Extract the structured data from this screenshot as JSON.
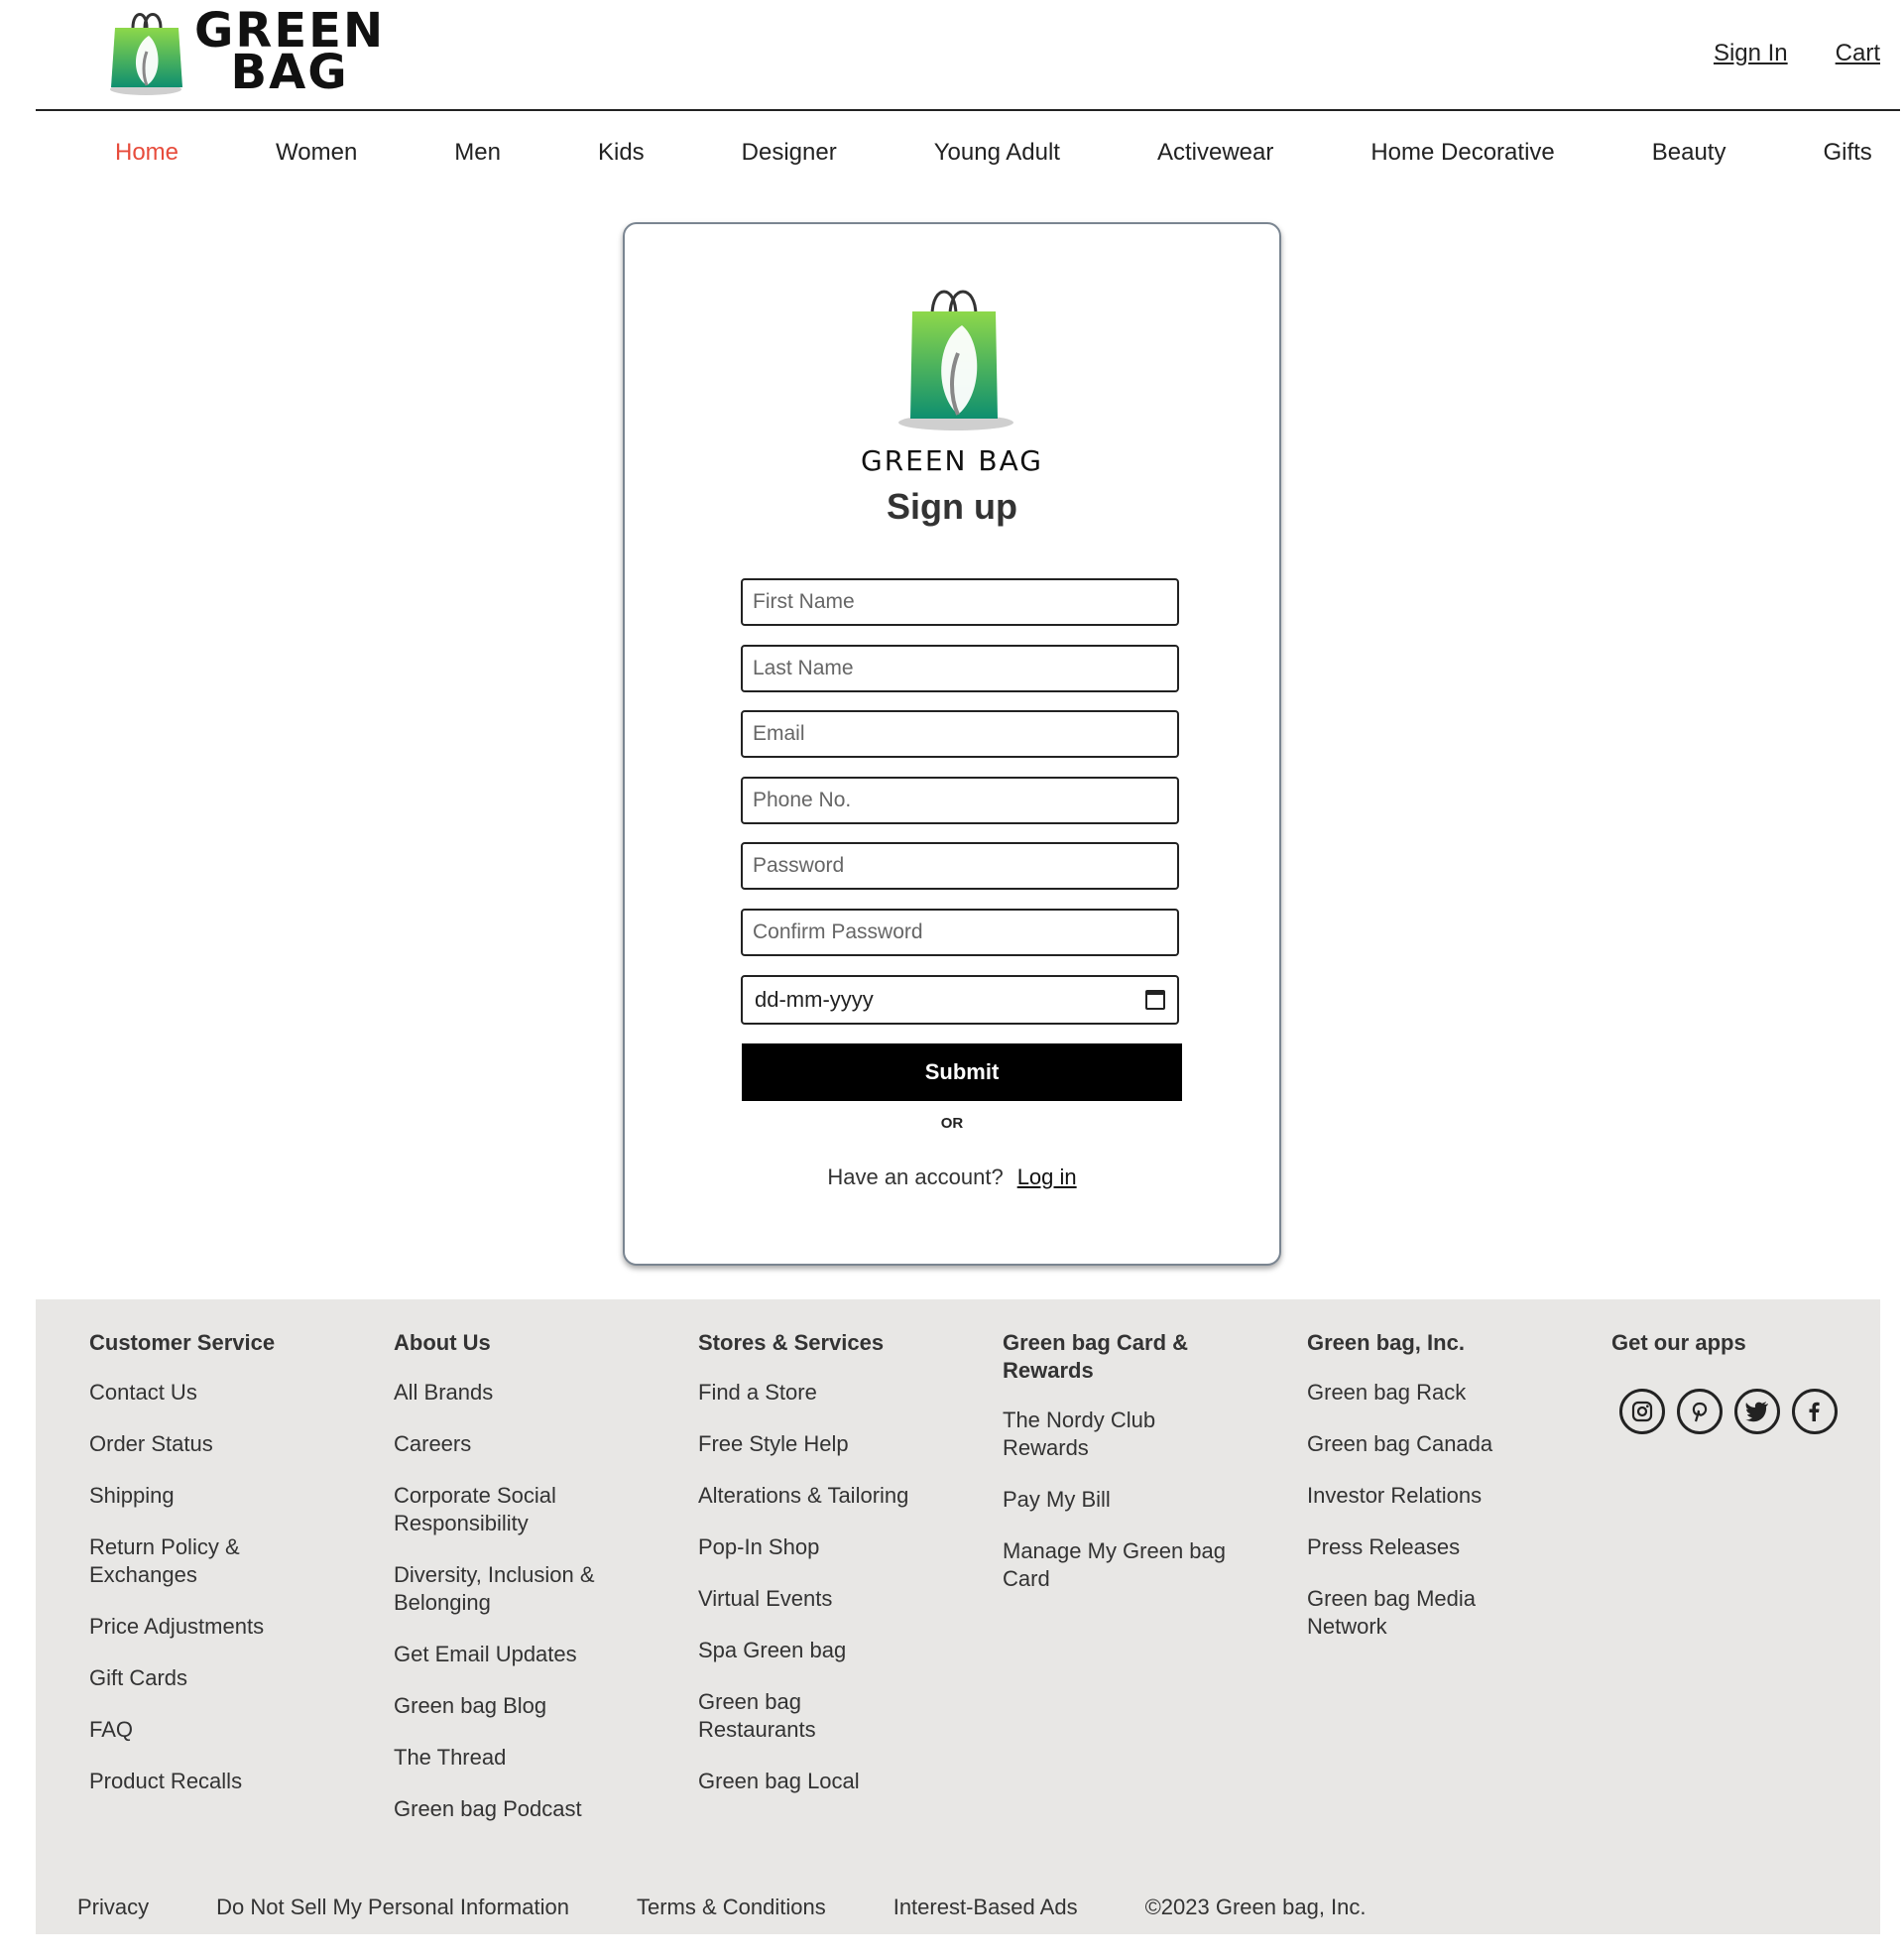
{
  "header": {
    "brand_line1": "GREEN",
    "brand_line2": "BAG",
    "sign_in": "Sign In",
    "cart": "Cart"
  },
  "nav": {
    "items": [
      "Home",
      "Women",
      "Men",
      "Kids",
      "Designer",
      "Young Adult",
      "Activewear",
      "Home Decorative",
      "Beauty",
      "Gifts"
    ],
    "active": "Home"
  },
  "signup": {
    "brand": "GREEN BAG",
    "title": "Sign up",
    "first_name_placeholder": "First Name",
    "last_name_placeholder": "Last Name",
    "email_placeholder": "Email",
    "phone_placeholder": "Phone No.",
    "password_placeholder": "Password",
    "confirm_password_placeholder": "Confirm Password",
    "date_placeholder": "dd-mm-yyyy",
    "submit_label": "Submit",
    "or_label": "OR",
    "have_account": "Have an account?",
    "login_link": "Log in"
  },
  "footer": {
    "columns": [
      {
        "title": "Customer Service",
        "items": [
          "Contact Us",
          "Order Status",
          "Shipping",
          "Return Policy & Exchanges",
          "Price Adjustments",
          "Gift Cards",
          "FAQ",
          "Product Recalls"
        ]
      },
      {
        "title": "About Us",
        "items": [
          "All Brands",
          "Careers",
          "Corporate Social Responsibility",
          "Diversity, Inclusion & Belonging",
          "Get Email Updates",
          "Green bag Blog",
          "The Thread",
          "Green bag Podcast"
        ]
      },
      {
        "title": "Stores & Services",
        "items": [
          "Find a Store",
          "Free Style Help",
          "Alterations & Tailoring",
          "Pop-In Shop",
          "Virtual Events",
          "Spa Green bag",
          "Green bag Restaurants",
          "Green bag Local"
        ]
      },
      {
        "title": "Green bag Card & Rewards",
        "items": [
          "The Nordy Club Rewards",
          "Pay My Bill",
          "Manage My Green bag Card"
        ]
      },
      {
        "title": "Green bag, Inc.",
        "items": [
          "Green bag Rack",
          "Green bag Canada",
          "Investor Relations",
          "Press Releases",
          "Green bag Media Network"
        ]
      }
    ],
    "apps_title": "Get our apps",
    "apps": [
      "instagram-icon",
      "pinterest-icon",
      "twitter-icon",
      "facebook-icon"
    ],
    "legal": [
      "Privacy",
      "Do Not Sell My Personal Information",
      "Terms & Conditions",
      "Interest-Based Ads",
      "©2023 Green bag, Inc."
    ]
  },
  "colors": {
    "accent_active": "#e74c3c",
    "bag_green": "#2ea84f",
    "footer_bg": "#e8e7e5",
    "submit_bg": "#000000"
  }
}
